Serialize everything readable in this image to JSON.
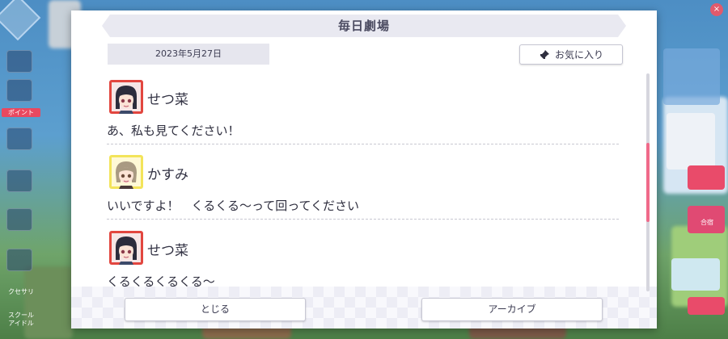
{
  "dialog": {
    "title": "毎日劇場",
    "date": "2023年5月27日",
    "favorite_label": "お気に入り",
    "close_label": "とじる",
    "archive_label": "アーカイブ"
  },
  "messages": [
    {
      "speaker": "せつ菜",
      "text": "あ、私も見てください！",
      "avatar": "setsuna-avatar"
    },
    {
      "speaker": "かすみ",
      "text": "いいですよ！　くるくる～って回ってください",
      "avatar": "kasumi-avatar"
    },
    {
      "speaker": "せつ菜",
      "text": "くるくるくるくる～",
      "avatar": "setsuna-avatar"
    }
  ],
  "scrollbar": {
    "position_fraction": 0.35
  },
  "colors": {
    "accent_pink": "#f06a8a",
    "setsuna_frame": "#e2463f",
    "kasumi_frame": "#f3e45a"
  },
  "background": {
    "sidebar_labels": [
      "ポイント",
      "クセサリ",
      "スクール\nアイドル"
    ],
    "right_labels": [
      "合宿"
    ]
  }
}
